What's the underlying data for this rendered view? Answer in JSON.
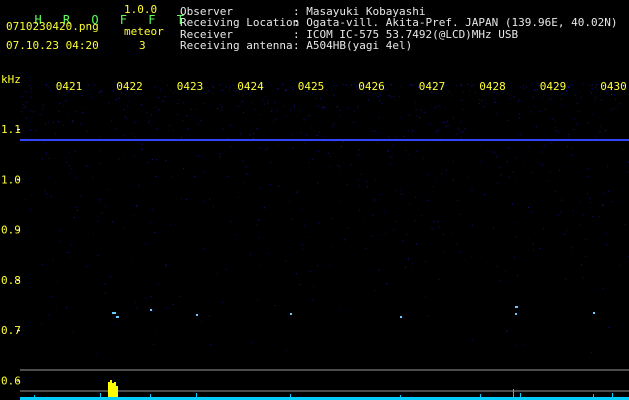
{
  "app": {
    "title": "H R O F F T",
    "version": "1.0.0"
  },
  "file": {
    "name": "0710230420.png",
    "datetime": "07.10.23 04:20"
  },
  "meteor": {
    "label": "meteor",
    "count": "3"
  },
  "info": {
    "rows": [
      {
        "label": "Observer",
        "value": ": Masayuki Kobayashi"
      },
      {
        "label": "Receiving Location",
        "value": ": Ogata-vill. Akita-Pref. JAPAN (139.96E, 40.02N)"
      },
      {
        "label": "Receiver",
        "value": ": ICOM IC-575 53.7492(@LCD)MHz USB"
      },
      {
        "label": "Receiving antenna",
        "value": ": A504HB(yagi 4el)"
      }
    ]
  },
  "spectrogram": {
    "unit_label": "kHz",
    "time_ticks": [
      "0421",
      "0422",
      "0423",
      "0424",
      "0425",
      "0426",
      "0427",
      "0428",
      "0429",
      "0430"
    ],
    "freq_ticks": [
      "1.1",
      "1.0",
      "0.9",
      "0.8",
      "0.7",
      "0.6"
    ],
    "colors": {
      "background": "#000000",
      "noise": "#1a1acc",
      "carrier": "#3344ff",
      "echo": "#66ccff",
      "spike": "#ffff00",
      "meter": "#00ccff",
      "axis_text": "#ffff33"
    }
  }
}
